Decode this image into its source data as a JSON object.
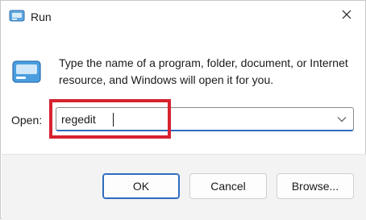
{
  "window": {
    "title": "Run",
    "app_icon": "run-icon",
    "close_icon": "close-icon"
  },
  "description": "Type the name of a program, folder, document, or Internet resource, and Windows will open it for you.",
  "open_field": {
    "label": "Open:",
    "value": "regedit",
    "dropdown_icon": "chevron-down-icon"
  },
  "buttons": {
    "ok": "OK",
    "cancel": "Cancel",
    "browse": "Browse..."
  },
  "colors": {
    "accent": "#2d6cc0",
    "highlight": "#d62230",
    "footer_bg": "#f3f3f3"
  }
}
